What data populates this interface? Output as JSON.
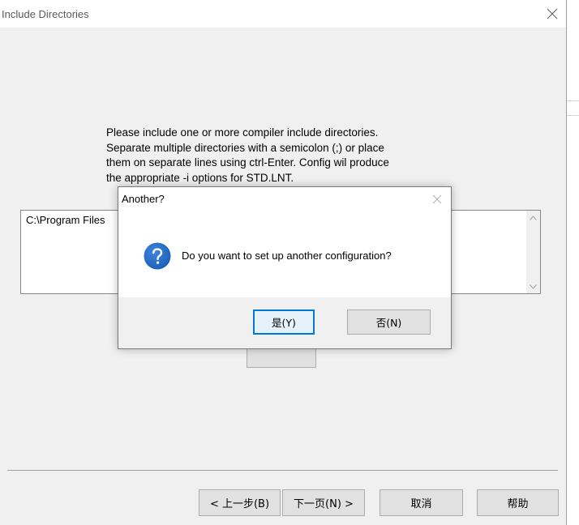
{
  "main_window": {
    "title": "Include Directories",
    "instructions": "Please include one or more compiler include directories.\nSeparate multiple directories with a semicolon (;) or place\nthem on separate lines using ctrl-Enter.  Config wil produce\nthe appropriate -i options for STD.LNT.",
    "include_paths_value": "C:\\Program Files",
    "buttons": {
      "back": "< 上一步(B)",
      "next": "下一页(N) >",
      "cancel": "取消",
      "help": "帮助"
    }
  },
  "message_box": {
    "title": "Another?",
    "message": "Do you want to set up another configuration?",
    "icon": "question-icon",
    "buttons": {
      "yes": "是(Y)",
      "no": "否(N)"
    }
  },
  "colors": {
    "accent": "#0078d7",
    "icon_blue": "#1a5fb4",
    "window_bg": "#f0f0f0"
  }
}
